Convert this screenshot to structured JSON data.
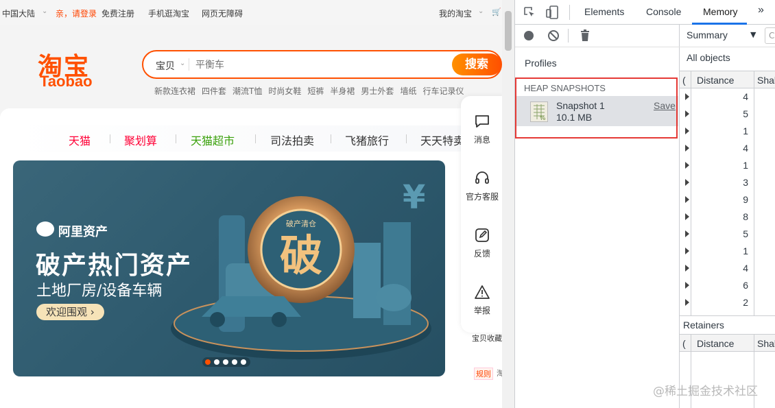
{
  "topbar": {
    "region": "中国大陆",
    "login": "亲，请登录",
    "register": "免费注册",
    "mobile": "手机逛淘宝",
    "accessible": "网页无障碍",
    "my_taobao": "我的淘宝",
    "cart": "购"
  },
  "logo": {
    "cn": "淘宝",
    "en": "Taobao"
  },
  "search": {
    "category": "宝贝",
    "placeholder": "平衡车",
    "button": "搜索",
    "hotwords": [
      "新款连衣裙",
      "四件套",
      "潮流T恤",
      "时尚女鞋",
      "短裤",
      "半身裙",
      "男士外套",
      "墙纸",
      "行车记录仪"
    ]
  },
  "nav": {
    "tabs": [
      {
        "label": "天猫",
        "color": "#ff0036"
      },
      {
        "label": "聚划算",
        "color": "#ff0036"
      },
      {
        "label": "天猫超市",
        "color": "#3ba10c"
      },
      {
        "label": "司法拍卖",
        "color": "#333333"
      },
      {
        "label": "飞猪旅行",
        "color": "#333333"
      },
      {
        "label": "天天特卖",
        "color": "#333333"
      }
    ]
  },
  "banner": {
    "brand": "阿里资产",
    "title": "破产热门资产",
    "subtitle": "土地厂房/设备车辆",
    "cta": "欢迎围观",
    "coin_text": "破",
    "coin_ring": "破产清仓",
    "slides_total": 5,
    "slide_active": 1
  },
  "sidebar": {
    "items": [
      {
        "label": "消息",
        "icon": "message-icon"
      },
      {
        "label": "官方客服",
        "icon": "headset-icon"
      },
      {
        "label": "反馈",
        "icon": "edit-icon"
      },
      {
        "label": "举报",
        "icon": "warning-icon"
      }
    ],
    "cut_text": "宝贝收藏",
    "rule_badge": "规则",
    "rule_text": "淘"
  },
  "devtools": {
    "tabs": [
      "Elements",
      "Console",
      "Memory"
    ],
    "active_tab": "Memory",
    "more": "»",
    "profiles_label": "Profiles",
    "heap_header": "HEAP SNAPSHOTS",
    "snapshot": {
      "name": "Snapshot 1",
      "size": "10.1 MB",
      "save": "Save"
    },
    "view_select": "Summary",
    "filter_placeholder": "C",
    "filter_scope": "All objects",
    "grid": {
      "col_constructor": "(",
      "col_distance": "Distance",
      "col_shallow": "Shal",
      "distances": [
        "4",
        "5",
        "1",
        "4",
        "1",
        "3",
        "9",
        "8",
        "5",
        "1",
        "4",
        "6",
        "2"
      ]
    },
    "retainers_label": "Retainers",
    "retainers_grid": {
      "col_constructor": "(",
      "col_distance": "Distance",
      "col_shallow": "Shal"
    }
  },
  "watermark": "@稀土掘金技术社区",
  "colors": {
    "taobao_orange": "#ff5000",
    "highlight_red": "#e53935",
    "devtools_blue": "#1a73e8"
  }
}
